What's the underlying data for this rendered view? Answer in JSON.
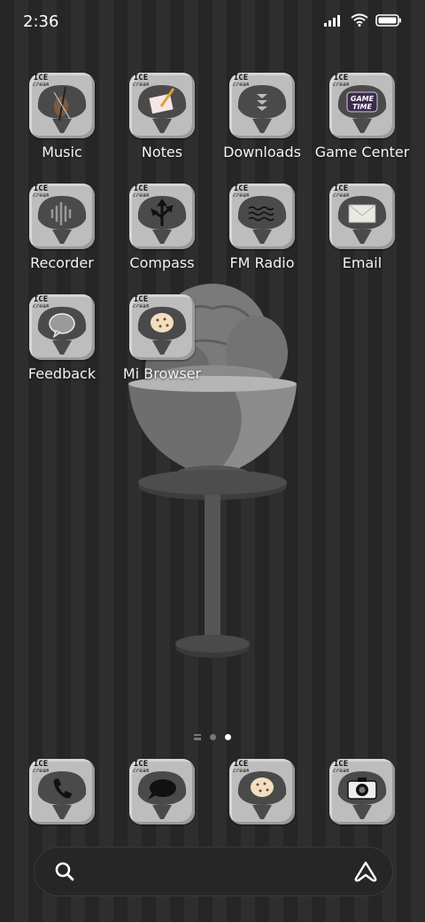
{
  "status_bar": {
    "time": "2:36",
    "signal_icon": "signal-icon",
    "wifi_icon": "wifi-icon",
    "battery_icon": "battery-icon"
  },
  "theme": {
    "badge_top": "ICE",
    "badge_bottom": "cream"
  },
  "apps": [
    {
      "label": "Music",
      "icon": "violin-icon"
    },
    {
      "label": "Notes",
      "icon": "notepad-icon"
    },
    {
      "label": "Downloads",
      "icon": "download-arrows-icon"
    },
    {
      "label": "Game Center",
      "icon": "game-time-icon",
      "icon_text_1": "GAME",
      "icon_text_2": "TIME"
    },
    {
      "label": "Recorder",
      "icon": "waveform-icon"
    },
    {
      "label": "Compass",
      "icon": "signpost-icon"
    },
    {
      "label": "FM Radio",
      "icon": "waves-icon"
    },
    {
      "label": "Email",
      "icon": "envelope-icon"
    },
    {
      "label": "Feedback",
      "icon": "speech-bubble-icon"
    },
    {
      "label": "Mi Browser",
      "icon": "cookie-icon"
    }
  ],
  "dock": [
    {
      "name": "phone",
      "icon": "phone-icon"
    },
    {
      "name": "messages",
      "icon": "chat-bubble-icon"
    },
    {
      "name": "browser",
      "icon": "cookie-icon"
    },
    {
      "name": "camera",
      "icon": "camera-icon"
    }
  ],
  "pager": {
    "pages": 2,
    "current": 2
  },
  "search_bar": {
    "search_icon": "search-icon",
    "assistant_icon": "assistant-icon"
  },
  "colors": {
    "tile": "#bdbdbd",
    "cream": "#4a4a4a",
    "background": "#262626"
  }
}
